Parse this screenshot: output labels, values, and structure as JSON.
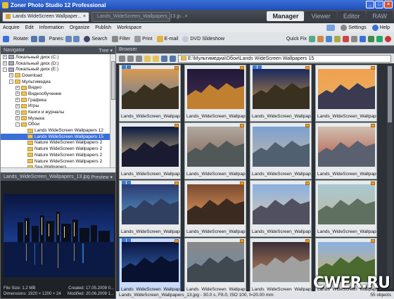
{
  "window": {
    "title": "Zoner Photo Studio 12 Professional"
  },
  "tabs": {
    "active": "Lands WideScreen Wallpaper...",
    "inactive": "Lands_WideScreen_Wallpapers_13.jp..."
  },
  "modes": [
    "Manager",
    "Viewer",
    "Editor",
    "RAW"
  ],
  "menu": {
    "items": [
      "Acquire",
      "Edit",
      "Information",
      "Organize",
      "Publish",
      "Workspace"
    ],
    "settings": "Settings",
    "help": "Help"
  },
  "toolbar": {
    "rotate": "Rotate:",
    "panes": "Panes:",
    "search": "Search",
    "filter": "Filter",
    "print": "Print",
    "email": "E-mail",
    "dvd": "DVD Slideshow",
    "quickfix": "Quick Fix"
  },
  "navigator": {
    "title": "Navigator",
    "view": "Tree",
    "tree": [
      {
        "label": "Локальный диск (C:)",
        "level": 0,
        "type": "drive",
        "tog": "+"
      },
      {
        "label": "Локальный диск (D:)",
        "level": 0,
        "type": "drive",
        "tog": "+"
      },
      {
        "label": "Локальный диск (E:)",
        "level": 0,
        "type": "drive",
        "tog": "-"
      },
      {
        "label": "Download",
        "level": 1,
        "type": "folder",
        "tog": "+"
      },
      {
        "label": "Мультимедиа",
        "level": 1,
        "type": "folder",
        "tog": "-"
      },
      {
        "label": "Видео",
        "level": 2,
        "type": "folder",
        "tog": "+"
      },
      {
        "label": "Видеообучение",
        "level": 2,
        "type": "folder",
        "tog": "+"
      },
      {
        "label": "Графика",
        "level": 2,
        "type": "folder",
        "tog": "+"
      },
      {
        "label": "Игры",
        "level": 2,
        "type": "folder",
        "tog": "+"
      },
      {
        "label": "Книги и журналы",
        "level": 2,
        "type": "folder",
        "tog": "+"
      },
      {
        "label": "Музыка",
        "level": 2,
        "type": "folder",
        "tog": "+"
      },
      {
        "label": "Обои",
        "level": 2,
        "type": "folder",
        "tog": "-"
      },
      {
        "label": "Lands WideScreen Wallpapers 12",
        "level": 3,
        "type": "folder",
        "tog": ""
      },
      {
        "label": "Lands WideScreen Wallpapers 15",
        "level": 3,
        "type": "folder",
        "tog": "",
        "selected": true
      },
      {
        "label": "Nature WideScreen Wallpapers 2",
        "level": 3,
        "type": "folder",
        "tog": ""
      },
      {
        "label": "Nature WideScreen Wallpapers 2",
        "level": 3,
        "type": "folder",
        "tog": ""
      },
      {
        "label": "Nature WideScreen Wallpapers 2",
        "level": 3,
        "type": "folder",
        "tog": ""
      },
      {
        "label": "Nature WideScreen Wallpapers 2",
        "level": 3,
        "type": "folder",
        "tog": ""
      },
      {
        "label": "Sea Wallpapers",
        "level": 3,
        "type": "folder",
        "tog": ""
      }
    ]
  },
  "preview": {
    "title": "Lands_WideScreen_Wallpapers_13.jpg",
    "mode": "Preview",
    "filesize": "File Size: 1.2 MB",
    "created": "Created: 17.05.2009 0...",
    "dimensions": "Dimensions: 1920 × 1200 × 24",
    "modified": "Modified: 20.06.2009 1..."
  },
  "browser": {
    "title": "Browser",
    "path": "E:\\Мультимедиа\\Обои\\Lands WideScreen Wallpapers 15",
    "thumb_caption": "Lands_WideScreen_Wallpaper...",
    "status": "Lands_WideScreen_Wallpapers_13.jpg - 30.0 s, F8.0, ISO 100, f=20.00 mm",
    "count": "55 objects"
  },
  "watermark": "CWER.RU"
}
